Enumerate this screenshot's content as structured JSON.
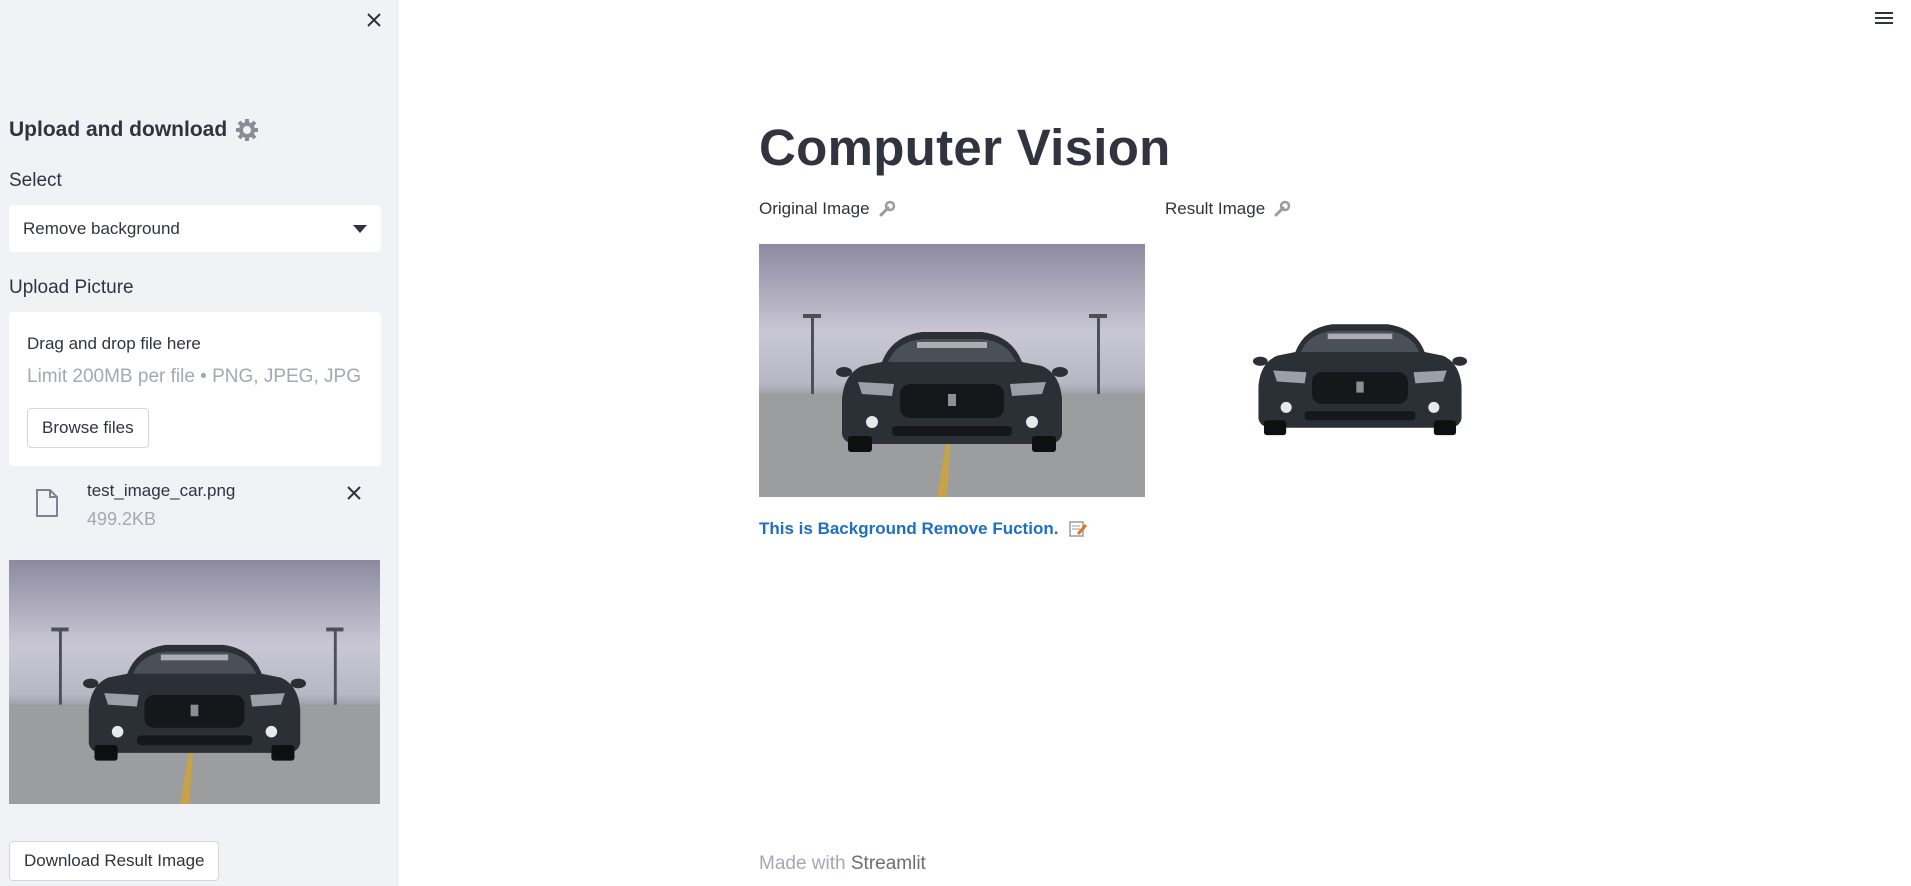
{
  "sidebar": {
    "title": "Upload and download",
    "title_icon": "gear-icon",
    "select_label": "Select",
    "select_value": "Remove background",
    "upload_label": "Upload Picture",
    "dropzone": {
      "title": "Drag and drop file here",
      "limit": "Limit 200MB per file • PNG, JPEG, JPG",
      "browse_label": "Browse files"
    },
    "file": {
      "name": "test_image_car.png",
      "size": "499.2KB"
    },
    "download_label": "Download Result Image"
  },
  "main": {
    "title": "Computer Vision",
    "original_label": "Original Image",
    "result_label": "Result Image",
    "label_icon": "wrench-icon",
    "info_text": "This is Background Remove Fuction.",
    "info_icon": "memo-icon",
    "footer_prefix": "Made with",
    "footer_brand": "Streamlit"
  },
  "colors": {
    "sidebar_bg": "#f0f2f6",
    "text": "#31333f",
    "muted": "#a3a8b4",
    "link": "#1c6fc4"
  }
}
